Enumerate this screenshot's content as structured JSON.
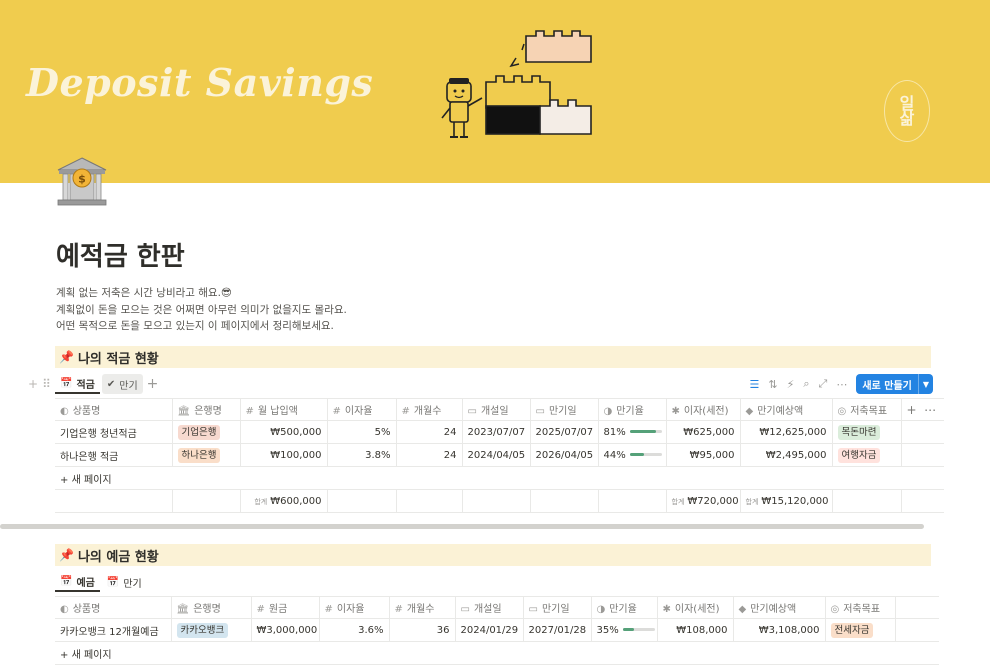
{
  "cover": {
    "title": "Deposit Savings",
    "logo_text": "일\n삶",
    "background": "#f0cc4e"
  },
  "page": {
    "icon": "bank-icon",
    "title": "예적금 한판",
    "description": [
      "계획 없는 저축은 시간 낭비라고 해요.😎",
      "계획없이 돈을 모으는 것은 어쩌면 아무런 의미가 없을지도 몰라요.",
      "어떤 목적으로 돈을 모으고 있는지 이 페이지에서 정리해보세요."
    ]
  },
  "savings": {
    "heading": "나의 적금 현황",
    "views": [
      {
        "label": "적금",
        "icon": "calendar-icon"
      },
      {
        "label": "만기",
        "icon": "check-circle-icon"
      }
    ],
    "new_button": "새로 만들기",
    "columns": [
      "상품명",
      "은행명",
      "월 납입액",
      "이자율",
      "개월수",
      "개설일",
      "만기일",
      "만기율",
      "이자(세전)",
      "만기예상액",
      "저축목표"
    ],
    "rows": [
      {
        "name": "기업은행 청년적금",
        "bank": "기업은행",
        "bank_color": "#f7d9cf",
        "monthly": "₩500,000",
        "rate": "5%",
        "months": "24",
        "open": "2023/07/07",
        "maturity": "2025/07/07",
        "progress_label": "81%",
        "progress": 0.81,
        "interest": "₩625,000",
        "expected": "₩12,625,000",
        "goal": "목돈마련",
        "goal_color": "#dbeddb"
      },
      {
        "name": "하나은행 적금",
        "bank": "하나은행",
        "bank_color": "#fadec9",
        "monthly": "₩100,000",
        "rate": "3.8%",
        "months": "24",
        "open": "2024/04/05",
        "maturity": "2026/04/05",
        "progress_label": "44%",
        "progress": 0.44,
        "interest": "₩95,000",
        "expected": "₩2,495,000",
        "goal": "여행자금",
        "goal_color": "#ffe2dd"
      }
    ],
    "new_page": "새 페이지",
    "sum_label": "합계",
    "sum_monthly": "₩600,000",
    "sum_interest": "₩720,000",
    "sum_expected": "₩15,120,000"
  },
  "deposits": {
    "heading": "나의 예금 현황",
    "views": [
      {
        "label": "예금",
        "icon": "calendar-icon"
      },
      {
        "label": "만기",
        "icon": "calendar-icon"
      }
    ],
    "columns": [
      "상품명",
      "은행명",
      "원금",
      "이자율",
      "개월수",
      "개설일",
      "만기일",
      "만기율",
      "이자(세전)",
      "만기예상액",
      "저축목표"
    ],
    "rows": [
      {
        "name": "카카오뱅크 12개월예금",
        "bank": "카카오뱅크",
        "bank_color": "#d3e5ef",
        "principal": "₩3,000,000",
        "rate": "3.6%",
        "months": "36",
        "open": "2024/01/29",
        "maturity": "2027/01/28",
        "progress_label": "35%",
        "progress": 0.35,
        "interest": "₩108,000",
        "expected": "₩3,108,000",
        "goal": "전세자금",
        "goal_color": "#fadec9"
      }
    ],
    "new_page": "새 페이지"
  }
}
